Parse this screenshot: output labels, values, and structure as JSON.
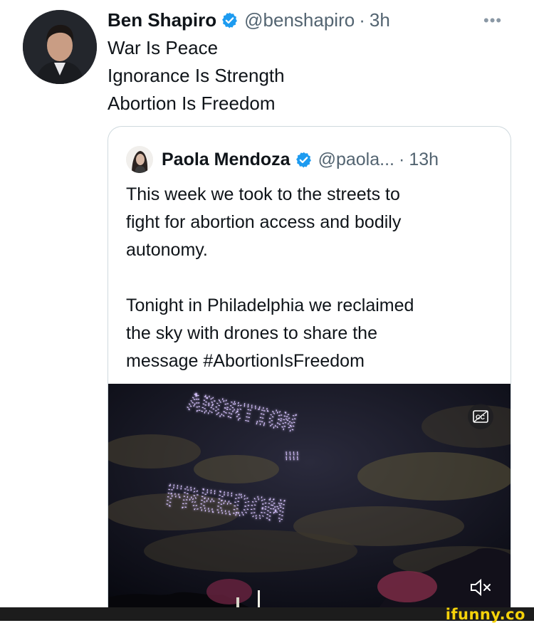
{
  "tweet": {
    "author_name": "Ben Shapiro",
    "handle": "@benshapiro",
    "separator": "·",
    "time": "3h",
    "more_label": "•••",
    "lines": [
      "War Is Peace",
      "Ignorance Is Strength",
      "Abortion Is Freedom"
    ]
  },
  "quote": {
    "author_name": "Paola Mendoza",
    "handle": "@paola...",
    "separator": "·",
    "time": "13h",
    "lines": [
      "This week we took to the streets to",
      "fight for abortion access and bodily",
      "autonomy.",
      "",
      "Tonight in Philadelphia we reclaimed",
      "the sky with drones to share the",
      "message #AbortionIsFreedom"
    ]
  },
  "media": {
    "drone_text_line1": "ABORTION",
    "drone_text_line2": "=",
    "drone_text_line3": "FREEDOM",
    "icons": [
      "captions-icon",
      "volume-muted-icon"
    ]
  },
  "footer": {
    "watermark": "ifunny.co"
  },
  "colors": {
    "verified": "#1d9bf0",
    "muted_text": "#536471",
    "watermark": "#f5d20a",
    "drone_lights": "#c9a8ff"
  }
}
